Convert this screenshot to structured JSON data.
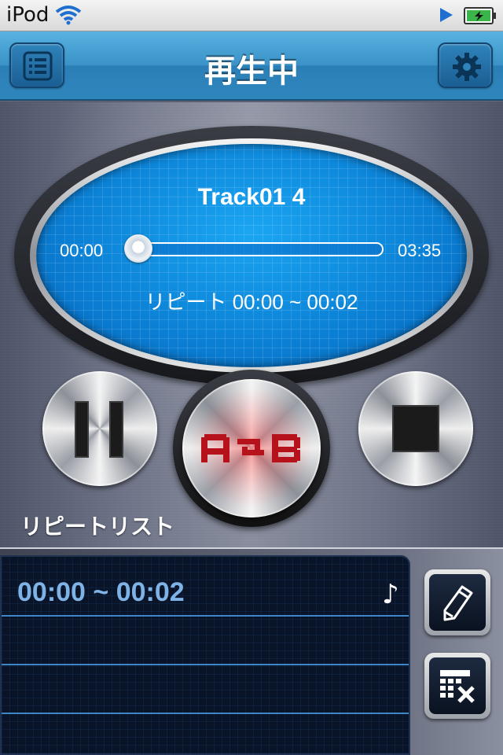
{
  "status_bar": {
    "carrier": "iPod",
    "wifi_icon": "wifi-icon",
    "play_indicator_icon": "play-indicator-icon",
    "battery_icon": "battery-charging-icon"
  },
  "nav": {
    "title": "再生中",
    "left_icon": "list-icon",
    "right_icon": "gear-icon"
  },
  "player": {
    "track_title": "Track01 4",
    "current_time": "00:00",
    "total_time": "03:35",
    "progress": 0.0,
    "repeat_text": "リピート 00:00 ~ 00:02",
    "accent_color": "#0a7fd4"
  },
  "controls": {
    "pause_icon": "pause-icon",
    "ab_repeat_icon": "ab-repeat-icon",
    "stop_icon": "stop-icon"
  },
  "repeat_list": {
    "label": "リピートリスト",
    "items": [
      {
        "text": "00:00 ~ 00:02",
        "note": "♪"
      },
      {
        "text": "",
        "note": ""
      },
      {
        "text": "",
        "note": ""
      },
      {
        "text": "",
        "note": ""
      }
    ],
    "edit_icon": "pencil-icon",
    "delete_icon": "delete-list-icon"
  }
}
